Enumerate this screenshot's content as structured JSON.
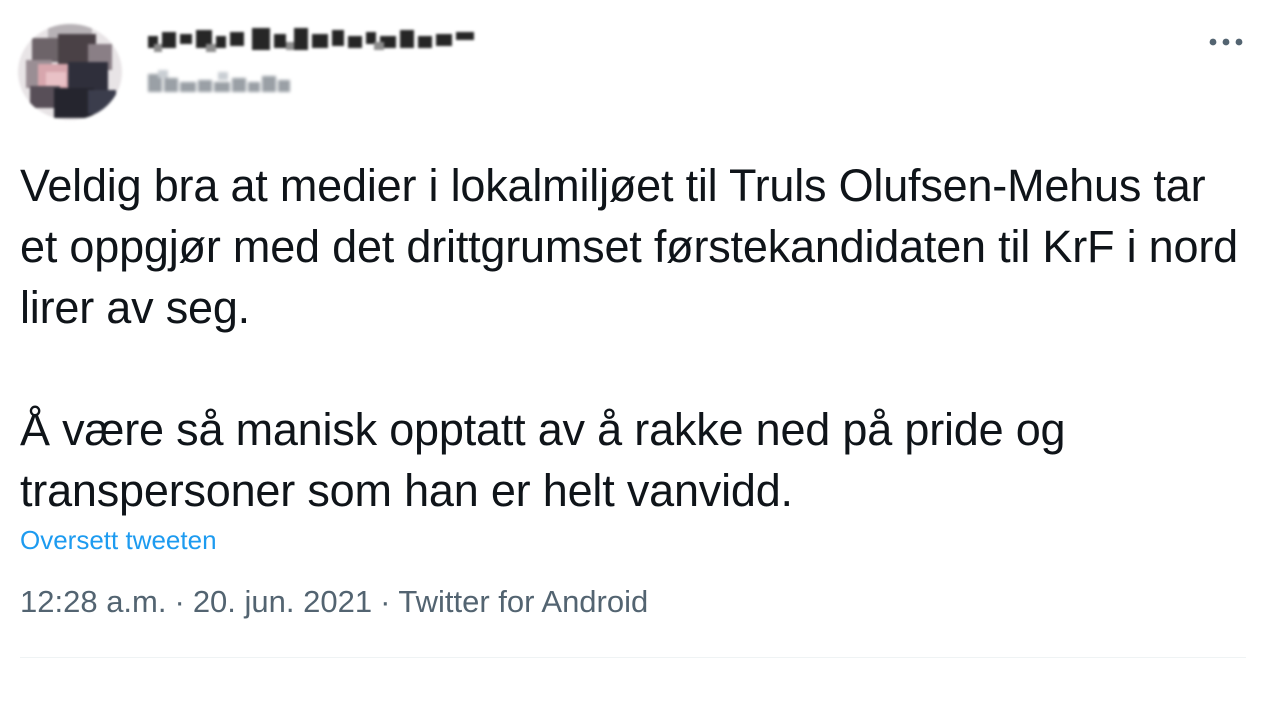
{
  "tweet": {
    "more_icon": "more-horizontal-icon",
    "paragraphs": [
      "Veldig bra at medier i lokalmiljøet til Truls Olufsen-Mehus tar et oppgjør med det drittgrumset førstekandidaten til KrF i nord lirer av seg.",
      "Å være så manisk opptatt av å rakke ned på pride og transpersoner som han er helt vanvidd."
    ],
    "translate_label": "Oversett tweeten",
    "time": "12:28 a.m.",
    "separator": "·",
    "date": "20. jun. 2021",
    "source": "Twitter for Android"
  },
  "colors": {
    "text": "#0f1419",
    "link": "#1d9bf0",
    "meta": "#536471",
    "divider": "#eff3f4"
  }
}
